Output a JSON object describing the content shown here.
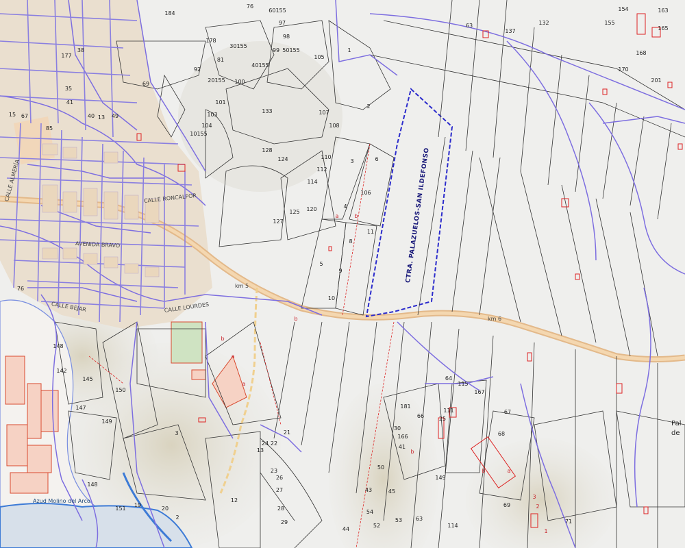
{
  "map": {
    "title": "",
    "road_labels": {
      "main_north": "CALLE RONCALFOR",
      "main_mid": "AVENIDA BRAVO",
      "lower": "CALLE LOURDES",
      "west": "CALLE ALMERÍA",
      "southwest": "CALLE BEJAR",
      "km_a": "km 5",
      "km_b": "km 6"
    },
    "cadastral_text": "CTRA. PALAZUELOS-SAN ILDEFONSO",
    "place_label": "Azud Molino del Arco",
    "edge_fragment": "Pal\nde",
    "parcel_labels": [
      "184",
      "76",
      "60155",
      "97",
      "98",
      "99",
      "50155",
      "105",
      "1",
      "2",
      "63",
      "137",
      "132",
      "155",
      "154",
      "163",
      "165",
      "168",
      "170",
      "201",
      "178",
      "81",
      "30155",
      "40155",
      "100",
      "69",
      "92",
      "20155",
      "101",
      "103",
      "104",
      "10155",
      "133",
      "107",
      "108",
      "128",
      "110",
      "124",
      "3",
      "6",
      "112",
      "114",
      "106",
      "4",
      "127",
      "125",
      "5",
      "9",
      "8",
      "11",
      "10",
      "120",
      "38",
      "41",
      "177",
      "35",
      "40",
      "49",
      "67",
      "15",
      "13",
      "85",
      "76",
      "142",
      "148",
      "145",
      "147",
      "149",
      "150",
      "148",
      "151",
      "19",
      "20",
      "2",
      "3",
      "12",
      "13",
      "21",
      "24",
      "22",
      "23",
      "26",
      "27",
      "28",
      "29",
      "30",
      "41",
      "50",
      "43",
      "44",
      "45",
      "52",
      "54",
      "53",
      "64",
      "63",
      "115",
      "114",
      "67",
      "68",
      "69",
      "71",
      "111",
      "66",
      "181",
      "167",
      "166",
      "149",
      "25",
      "26",
      "60"
    ],
    "red_labels": [
      "a",
      "b",
      "b",
      "a",
      "a",
      "b",
      "b",
      "a",
      "b",
      "1",
      "2",
      "3"
    ]
  }
}
